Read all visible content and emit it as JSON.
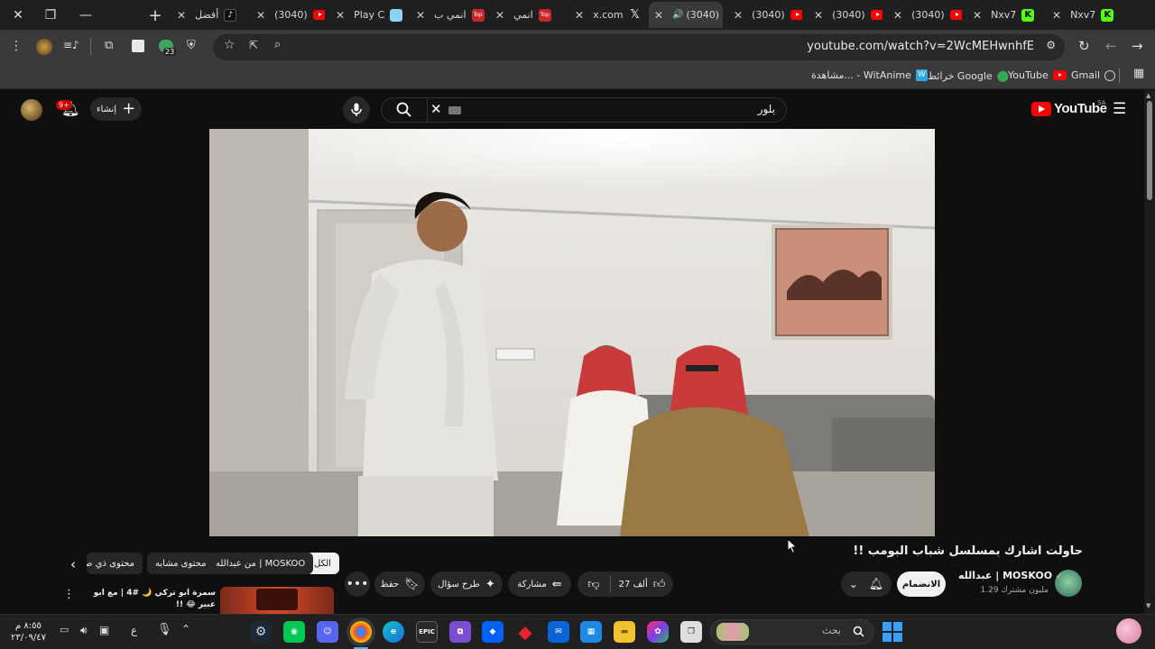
{
  "browser": {
    "tabs": [
      {
        "title": "أفضل",
        "icon": "tiktok-icon"
      },
      {
        "title": "(3040)",
        "icon": "youtube-icon"
      },
      {
        "title": "Play C",
        "icon": "app-icon"
      },
      {
        "title": "انمي ب",
        "icon": "top-icon"
      },
      {
        "title": "انمي",
        "icon": "top-icon"
      },
      {
        "title": "x.com",
        "icon": "x-logo-icon"
      },
      {
        "title": "(3040)",
        "icon": "youtube-icon",
        "active": true
      },
      {
        "title": "(3040)",
        "icon": "youtube-icon"
      },
      {
        "title": "(3040)",
        "icon": "youtube-icon"
      },
      {
        "title": "(3040)",
        "icon": "youtube-icon"
      },
      {
        "title": "Nxv7",
        "icon": "kick-icon"
      },
      {
        "title": "Nxv7",
        "icon": "kick-icon"
      }
    ],
    "extension_badge": "23",
    "url": "youtube.com/watch?v=2WcMEHwnhfE",
    "bookmarks": [
      {
        "label": "Gmail",
        "icon": "globe-icon"
      },
      {
        "label": "YouTube",
        "icon": "youtube-icon"
      },
      {
        "label": "خرائط Google",
        "icon": "maps-pin-icon"
      },
      {
        "label": "مشاهدة... - WitAnime",
        "icon": "witanime-icon"
      }
    ]
  },
  "youtube": {
    "logo_text": "YouTube",
    "region": "SA",
    "search_query": "بلور",
    "create_label": "إنشاء",
    "notifications_badge": "9+",
    "video": {
      "title": "حاولت اشارك بمسلسل شباب البومب !!",
      "channel_name": "عبدالله | MOSKOO",
      "subscribers": "1.29 مليون مشترك",
      "join_label": "الانضمام",
      "likes": "27 ألف",
      "share_label": "مشاركة",
      "ask_label": "طرح سؤال",
      "save_label": "حفظ"
    },
    "chips": [
      "الكل",
      "من عبدالله | MOSKOO",
      "محتوى مشابه",
      "محتوى ذي صلة"
    ],
    "suggested": {
      "title": "سمرة ابو تركي 🌙 #4 | مع ابو عبير 😂 !!"
    }
  },
  "taskbar": {
    "search_placeholder": "بحث",
    "time": "٨:٥٥ م",
    "date": "٢٣/٠٩/٤٧",
    "lang": "ع",
    "epic_label": "EPIC"
  },
  "colors": {
    "yt_red": "#ff0000",
    "accent_blue": "#3ea6ff",
    "kick_green": "#53fc18"
  }
}
